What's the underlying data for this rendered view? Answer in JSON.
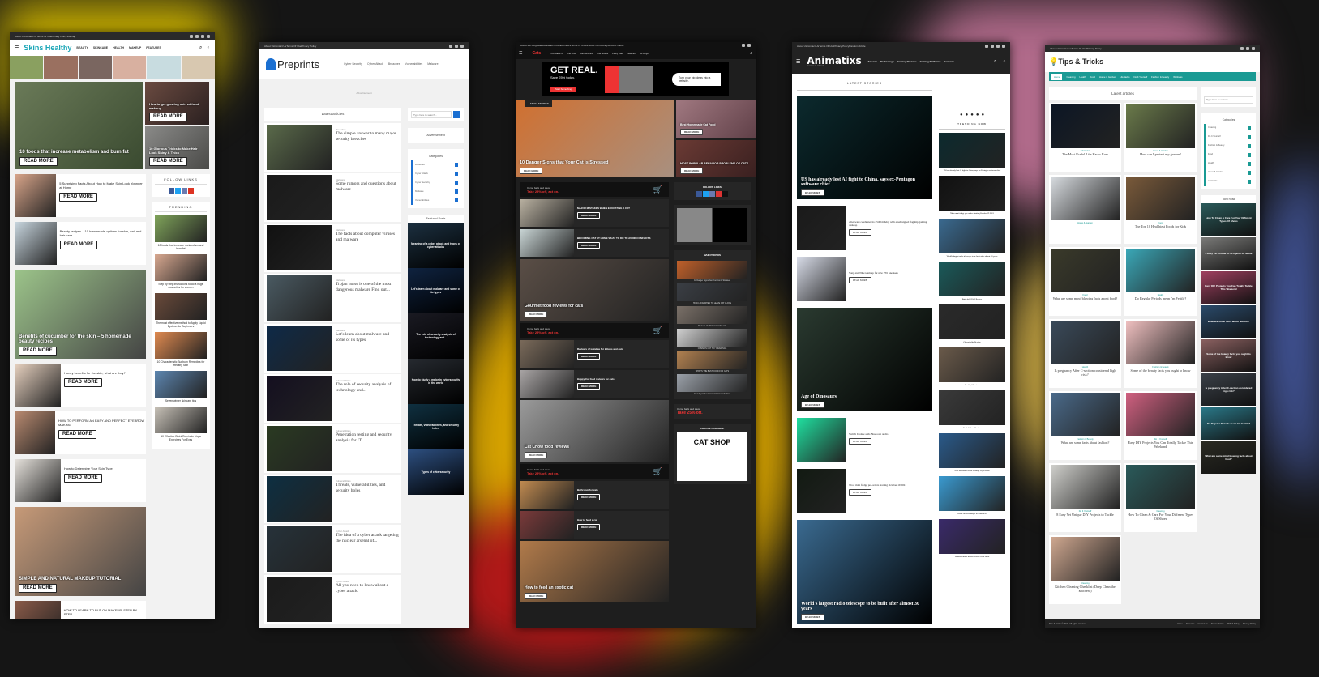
{
  "colors": {
    "skins_accent": "#1aa6b7",
    "preprints_accent": "#1a6fd1",
    "cat_accent": "#e33333",
    "tips_accent": "#1a9a94"
  },
  "skins": {
    "top_links": [
      "About Us",
      "Contact Us",
      "Terms Of Use",
      "Privacy Policy",
      "Sitemap"
    ],
    "logo": "Skins Healthy",
    "nav": [
      "BEAUTY",
      "SKINCARE",
      "HEALTH",
      "MAKEUP",
      "FEATURES"
    ],
    "read_more": "READ MORE",
    "hero_main": "10 foods that increase metabolism and burn fat",
    "hero_side": [
      "How to get glowing skin without makeup",
      "10 Glorious Tricks to Make Hair Look Shiny & Thick"
    ],
    "articles": [
      {
        "title": "5 Surprising Facts About How to Make Skin Look Younger at Home",
        "big": false,
        "img": "#d9a58a"
      },
      {
        "title": "Beauty recipes – 10 homemade options for skin, nail and hair care",
        "big": false,
        "img": "#c9d7e0"
      },
      {
        "title": "Benefits of cucumber for the skin – 5 homemade beauty recipes",
        "big": true,
        "img": "#9cc48a"
      },
      {
        "title": "Honey benefits for the skin, what are they?",
        "big": false,
        "img": "#e8d2c0"
      },
      {
        "title": "HOW TO PERFORM AN EASY AND PERFECT EYEBROW MAKING",
        "big": false,
        "img": "#b98a70"
      },
      {
        "title": "How to Determine Your Skin Type",
        "big": false,
        "img": "#e6e2dc"
      },
      {
        "title": "SIMPLE AND NATURAL MAKEUP TUTORIAL",
        "big": true,
        "img": "#c79a78"
      },
      {
        "title": "HOW TO LEARN TO PUT ON MAKEUP: STEP BY STEP",
        "big": false,
        "img": "#8a5a48"
      }
    ],
    "follow_title": "FOLLOW LINKS",
    "trending_title": "TRENDING",
    "trending": [
      {
        "title": "10 foods that increase metabolism and burn fat",
        "img": "#7fa35a"
      },
      {
        "title": "Step by step instructions to do a huge cosmetics for women",
        "img": "#d8a890"
      },
      {
        "title": "The most effective method to Apply Liquid Eyeliner for Beginners",
        "img": "#6a4a3a"
      },
      {
        "title": "10 Characteristic Sunburn Remedies for Healthy Skin",
        "img": "#e08a50"
      },
      {
        "title": "Seven winter skincare tips",
        "img": "#5d86b0"
      },
      {
        "title": "10 Effective Bikini Reminder Yoga Exercises For Eyes",
        "img": "#c8c2b8"
      }
    ]
  },
  "preprints": {
    "top_links": [
      "About Us",
      "Contact Us",
      "Terms Of Use",
      "Privacy Policy"
    ],
    "logo": "Preprints",
    "nav": [
      "Cyber Security",
      "Cyber Attack",
      "Breaches",
      "Vulnerabilities",
      "Malware"
    ],
    "advertisement": "Advertisement",
    "latest": "Latest articles",
    "articles": [
      {
        "cat": "Breaches",
        "title": "The simple answer to many major security breaches",
        "img": "#5a6a4a"
      },
      {
        "cat": "Malware",
        "title": "Some rumors and questions about malware",
        "img": "#1a1a1a"
      },
      {
        "cat": "Malware",
        "title": "The facts about computer viruses and malware",
        "img": "#111111"
      },
      {
        "cat": "Malware",
        "title": "Trojan horse is one of the most dangerous malware Find out...",
        "img": "#4a5a62"
      },
      {
        "cat": "Malware",
        "title": "Let's learn about malware and some of its types",
        "img": "#0e2a48"
      },
      {
        "cat": "Vulnerabilities",
        "title": "The role of security analysis of technology and...",
        "img": "#140f20"
      },
      {
        "cat": "Vulnerabilities",
        "title": "Penetration testing and security analysis for IT",
        "img": "#2a3a22"
      },
      {
        "cat": "Vulnerabilities",
        "title": "Threats, vulnerabilities, and security holes",
        "img": "#0d2f42"
      },
      {
        "cat": "Cyber Attack",
        "title": "The idea of a cyber attack targeting the nuclear arsenal of...",
        "img": "#26323a"
      },
      {
        "cat": "Cyber Attack",
        "title": "All you need to know about a cyber attack",
        "img": "#1b1b1b"
      }
    ],
    "search_placeholder": "Type here to search...",
    "sidebar_ad": "Advertisement",
    "categories_title": "Categories",
    "categories": [
      "Breaches",
      "Cyber Attack",
      "Cyber Security",
      "Malware",
      "Vulnerabilities"
    ],
    "featured_title": "Featured Posts",
    "featured": [
      {
        "title": "Meaning of a cyber attack and types of cyber attacks",
        "img": "#1c3040"
      },
      {
        "title": "Let's learn about malware and some of its types",
        "img": "#0f2340"
      },
      {
        "title": "The role of security analysis of technology and...",
        "img": "#1a1a22"
      },
      {
        "title": "How to study a major in cybersecurity in the world",
        "img": "#262a30"
      },
      {
        "title": "Threats, vulnerabilities, and security holes",
        "img": "#0f3040"
      },
      {
        "title": "Types of cybersecurity",
        "img": "#2d4f80"
      }
    ]
  },
  "catsite": {
    "top_links": [
      "About the Blog",
      "Awards",
      "Research",
      "CAREGIVERS",
      "Terms Of Use",
      "ANIMAL Community",
      "Member Cards"
    ],
    "logo": "Cats",
    "nav": [
      "CAT HEALTH",
      "Cat Food",
      "Cat Behaviour",
      "Cat Breeds",
      "Funny Cats",
      "Features",
      "Vet Blogs"
    ],
    "ad_headline": "GET REAL.",
    "ad_sub": "Save 25% today.",
    "ad_button": "Start Something",
    "ad_bubble": "Turn your big ideas into a website.",
    "latest_tag": "LATEST STORIES",
    "read_more": "READ MORE",
    "hero_main": "10 Danger Signs that Your Cat is Stressed",
    "hero_side": [
      "Best Homemade Cat Food",
      "MOST POPULAR BEHAVIOR PROBLEMS OF CATS"
    ],
    "strip_line1": "Come back and save.",
    "strip_line2": "Take 25% off, act on.",
    "articles": [
      {
        "type": "strip"
      },
      {
        "type": "row",
        "title": "MAJOR MISTAKES WHEN EDUCATING A CAT",
        "img": "#b8b0a0"
      },
      {
        "type": "row",
        "title": "BECOMING CAT AT HOME WHAT TO DO TO AVOID CONFLICTS",
        "img": "#c8d4d4"
      },
      {
        "type": "big",
        "title": "Gourmet food reviews for cats",
        "img": "#5a4e46"
      },
      {
        "type": "strip"
      },
      {
        "type": "row",
        "title": "Reviews of whiskas for kittens and cats",
        "img": "#7a6a5a"
      },
      {
        "type": "row",
        "title": "Happy Cat food reviews for cats",
        "img": "#a8a4a4"
      },
      {
        "type": "big",
        "title": "Cat Chow food reviews",
        "img": "#9a9a9a"
      },
      {
        "type": "strip"
      },
      {
        "type": "row",
        "title": "Bathroom for cats",
        "img": "#c08a50"
      },
      {
        "type": "row",
        "title": "How to feed a cat",
        "img": "#7a3a3a"
      },
      {
        "type": "big",
        "title": "How to feed an exotic cat",
        "img": "#b07a4a"
      }
    ],
    "follow_title": "FOLLOW LINKS",
    "main_photos_title": "MAIN PHOTOS",
    "main_photos": [
      {
        "title": "10 Danger Signs that Your Cat is Stressed",
        "img": "#c0602a"
      },
      {
        "title": "HOW LONG WHEN TO LEAVE CAT ALONE",
        "img": "#3a3e44"
      },
      {
        "title": "Reviews of whiskas food for cats",
        "img": "#7a7068"
      },
      {
        "title": "COMMON CAT TOY DRAWINGS",
        "img": "#d0d0d0"
      },
      {
        "title": "WHAT'S THE BEST FOOD FOR CATS",
        "img": "#b08050"
      },
      {
        "title": "Should you feed your cat homemade food",
        "img": "#9aa0a8"
      }
    ],
    "side_ad_line1": "Come back and save.",
    "side_ad_line2": "Take 25% off.",
    "shop_title": "CHOOSE OUR SHOP",
    "shop_logo": "CAT SHOP"
  },
  "animatixs": {
    "top_links": [
      "About Us",
      "Contact Us",
      "Terms Of Use",
      "Privacy Policy",
      "Random Article"
    ],
    "logo": "Animatixs",
    "tagline": "Games & Cheats",
    "nav": [
      "Science",
      "Technology",
      "Gaming Reviews",
      "Gaming Platforms",
      "Features"
    ],
    "latest": "LATEST STORIES",
    "read_more": "READ MORE",
    "articles": [
      {
        "title": "US has already lost AI fight to China, says ex-Pentagon software chief",
        "big": true,
        "img": "#0c2a2e"
      },
      {
        "title": "Alienware celebrates its 25th birthday with a redesigned flagship gaming desktop",
        "big": false,
        "img": "#1a1a1a"
      },
      {
        "title": "Sony and Nike team up for new PS5 Sneakers",
        "big": false,
        "img": "#d8dce8"
      },
      {
        "title": "Age of Dinosaurs",
        "big": true,
        "img": "#2a3a30"
      },
      {
        "title": "Switch Update adds Bluetooth audio",
        "big": false,
        "img": "#20e0a0"
      },
      {
        "title": "Xbox mini fridge pre-orders starting October 19 2021",
        "big": false,
        "img": "#121a12"
      },
      {
        "title": "World's largest radio telescope to be built after almost 30 years",
        "big": true,
        "img": "#3a6a90"
      }
    ],
    "trending_title": "TRENDING NOW",
    "trending": [
      {
        "title": "US has already lost AI fight to China, says ex-Pentagon software chief",
        "img": "#0c2a2e"
      },
      {
        "title": "Xbox mini fridge pre-orders starting October 19 2021",
        "img": "#111"
      },
      {
        "title": "World's largest radio telescope to be built after almost 30 years",
        "img": "#3a6a90"
      },
      {
        "title": "Battlefield 2042 Review",
        "img": "#1a5a5a"
      },
      {
        "title": "Chernobylite Review",
        "img": "#2a2a2a"
      },
      {
        "title": "Far Cry 6 Review",
        "img": "#6a5a4a"
      },
      {
        "title": "Back 4 Blood Review",
        "img": "#3a3a3a"
      },
      {
        "title": "New Machine Eve on Destiny: Light Burst",
        "img": "#2a5a8a"
      },
      {
        "title": "Drone delivers burger to customers",
        "img": "#3a9ad0"
      },
      {
        "title": "Neuroscientists unlock secrets of the brain",
        "img": "#3a2a6a"
      }
    ]
  },
  "tips": {
    "top_links": [
      "About Us",
      "Contact us",
      "Terms Of Use",
      "Privacy Policy"
    ],
    "logo": "Tips & Tricks",
    "nav": [
      "Home",
      "Cleaning",
      "Health",
      "Food",
      "Home & Garden",
      "LifeHacks",
      "Do It Yourself",
      "Fashion & Beauty",
      "Wellness"
    ],
    "latest": "Latest articles",
    "articles": [
      {
        "cat": "LifeHacks",
        "title": "The Most Useful Life Hacks Ever",
        "img": "#0c1624"
      },
      {
        "cat": "Home & Garden",
        "title": "How can I protect my garden?",
        "img": "#6a7a4a"
      },
      {
        "cat": "Home & Garden",
        "title": "",
        "img": "#d8dce0"
      },
      {
        "cat": "Food",
        "title": "The Top 10 Healthiest Foods for Kids",
        "img": "#7a5a3a"
      },
      {
        "cat": "Food",
        "title": "What are some mind blowing facts about food?",
        "img": "#3a3a2a"
      },
      {
        "cat": "Health",
        "title": "Do Regular Periods mean I'm Fertile?",
        "img": "#3aa8b8"
      },
      {
        "cat": "Health",
        "title": "Is pregnancy After C-section considered high risk?",
        "img": "#3a4a5a"
      },
      {
        "cat": "Fashion & Beauty",
        "title": "Some of the beauty facts you ought to know",
        "img": "#f0c0c0"
      },
      {
        "cat": "Fashion & Beauty",
        "title": "What are some facts about fashion?",
        "img": "#4a6a8a"
      },
      {
        "cat": "Do It Yourself",
        "title": "Easy DIY Projects You Can Totally Tackle This Weekend",
        "img": "#d06080"
      },
      {
        "cat": "Do It Yourself",
        "title": "8 Easy Yet Unique DIY Projects to Tackle",
        "img": "#d0d0cc"
      },
      {
        "cat": "Cleaning",
        "title": "How To Clean & Care For Your Different Types Of Shoes",
        "img": "#2a5a5a"
      },
      {
        "cat": "Cleaning",
        "title": "Kitchen Cleaning Checklist (Deep Clean the Kitchen!)",
        "img": "#d0a890"
      }
    ],
    "search_placeholder": "Type here to search...",
    "categories_title": "Categories",
    "categories": [
      "Cleaning",
      "Do It Yourself",
      "Fashion & Beauty",
      "Food",
      "Health",
      "Home & Garden",
      "LifeHacks"
    ],
    "most_read_title": "Most Read",
    "most_read": [
      {
        "title": "How To Clean & Care For Your Different Types Of Shoes",
        "img": "#2a5a5a"
      },
      {
        "title": "8 Easy Yet Unique DIY Projects to Tackle",
        "img": "#7a7a78"
      },
      {
        "title": "Easy DIY Projects You Can Totally Tackle This Weekend",
        "img": "#a04060"
      },
      {
        "title": "What are some facts about fashion?",
        "img": "#2a4a6a"
      },
      {
        "title": "Some of the beauty facts you ought to know",
        "img": "#8a6060"
      },
      {
        "title": "Is pregnancy After C-section considered high risk?",
        "img": "#3a4048"
      },
      {
        "title": "Do Regular Periods mean I'm Fertile?",
        "img": "#2a7888"
      },
      {
        "title": "What are some mind blowing facts about food?",
        "img": "#2a2a22"
      }
    ],
    "footer_copy": "Tips & Tricks © 2023. All rights reserved.",
    "footer_links": [
      "Home",
      "About Us",
      "Contact us",
      "Terms Of Use",
      "DMCA Policy",
      "Privacy Policy"
    ]
  }
}
